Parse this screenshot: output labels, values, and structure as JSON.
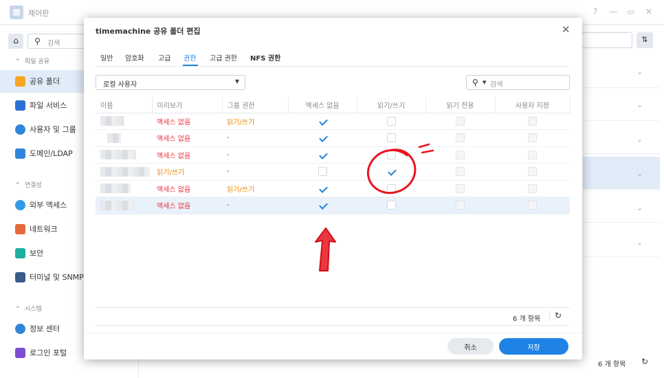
{
  "app": {
    "title": "제어판"
  },
  "window_controls": [
    "?",
    "—",
    "▭",
    "✕"
  ],
  "sidebar": {
    "search_placeholder": "검색",
    "sections": [
      {
        "label": "파일 공유",
        "items": [
          {
            "label": "공유 폴더",
            "active": true,
            "icon": "folder-icon",
            "color": "#f5a623"
          },
          {
            "label": "파일 서비스",
            "icon": "file-services-icon",
            "color": "#2b6fd6"
          },
          {
            "label": "사용자 및 그룹",
            "icon": "users-icon",
            "color": "#2f86d9"
          },
          {
            "label": "도메인/LDAP",
            "icon": "domain-icon",
            "color": "#2f86d9"
          }
        ]
      },
      {
        "label": "연결성",
        "items": [
          {
            "label": "외부 액세스",
            "icon": "globe-icon",
            "color": "#2f9be6"
          },
          {
            "label": "네트워크",
            "icon": "home-network-icon",
            "color": "#e56a3a"
          },
          {
            "label": "보안",
            "icon": "shield-icon",
            "color": "#1bb0a0"
          },
          {
            "label": "터미널 및 SNMP",
            "icon": "terminal-icon",
            "color": "#3b5b8a"
          }
        ]
      },
      {
        "label": "시스템",
        "items": [
          {
            "label": "정보 센터",
            "icon": "info-icon",
            "color": "#2f86d9"
          },
          {
            "label": "로그인 포털",
            "icon": "login-portal-icon",
            "color": "#7b4fd0"
          }
        ]
      }
    ]
  },
  "main": {
    "count_label": "6 개 항목"
  },
  "dialog": {
    "title": "timemachine 공유 폴더 편집",
    "tabs": [
      "일반",
      "암호화",
      "고급",
      "권한",
      "고급 권한",
      "NFS 권한"
    ],
    "active_tab": "권한",
    "user_type": "로컬 사용자",
    "search_placeholder": "검색",
    "columns": [
      "이름",
      "미리보기",
      "그룹 권한",
      "액세스 없음",
      "읽기/쓰기",
      "읽기 전용",
      "사용자 지정"
    ],
    "rows": [
      {
        "preview": "액세스 없음",
        "preview_color": "red",
        "group": "읽기/쓰기",
        "group_color": "orange",
        "perm": "none"
      },
      {
        "preview": "액세스 없음",
        "preview_color": "red",
        "group": "-",
        "group_color": "dash",
        "perm": "none"
      },
      {
        "preview": "액세스 없음",
        "preview_color": "red",
        "group": "-",
        "group_color": "dash",
        "perm": "none"
      },
      {
        "preview": "읽기/쓰기",
        "preview_color": "orange",
        "group": "-",
        "group_color": "dash",
        "perm": "rw"
      },
      {
        "preview": "액세스 없음",
        "preview_color": "red",
        "group": "읽기/쓰기",
        "group_color": "orange",
        "perm": "none"
      },
      {
        "preview": "액세스 없음",
        "preview_color": "red",
        "group": "-",
        "group_color": "dash",
        "perm": "none",
        "selected": true
      }
    ],
    "count_label": "6 개 항목",
    "cancel_label": "취소",
    "save_label": "저장"
  },
  "colors": {
    "accent": "#1f83e6",
    "red": "#e8323c",
    "orange": "#ea8a00",
    "annotation": "#e8141e"
  }
}
